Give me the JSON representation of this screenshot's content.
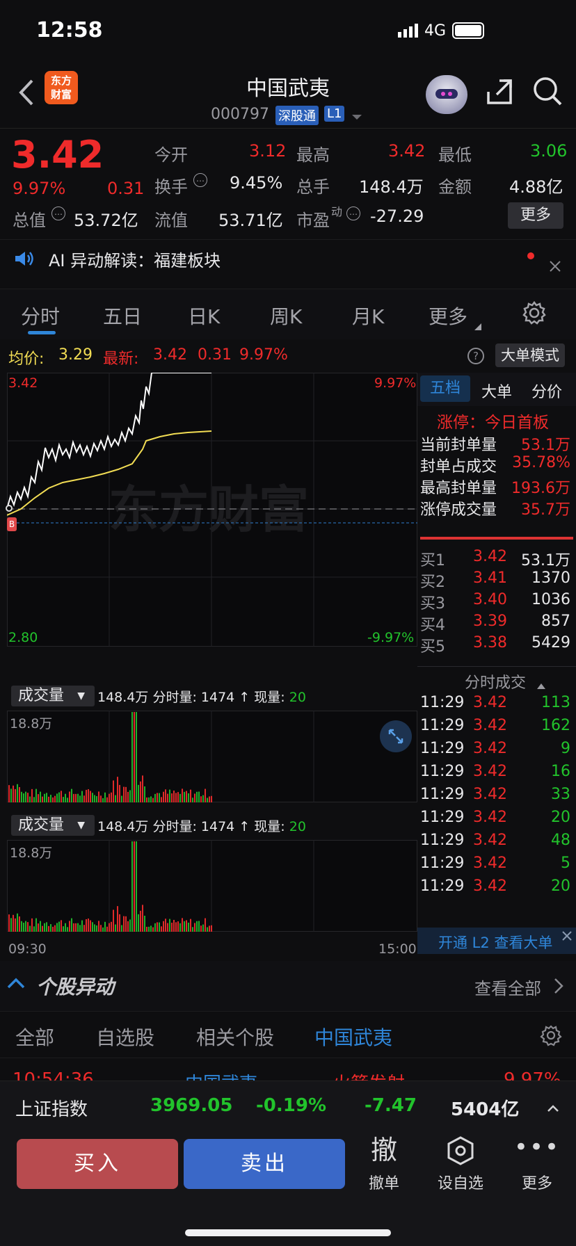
{
  "status": {
    "time": "12:58",
    "network": "4G"
  },
  "header": {
    "logo_line1": "东方",
    "logo_line2": "财富",
    "title": "中国武夷",
    "code": "000797",
    "badge1": "深股通",
    "badge2": "L1"
  },
  "quote": {
    "price": "3.42",
    "pct": "9.97%",
    "change": "0.31",
    "open_label": "今开",
    "open": "3.12",
    "high_label": "最高",
    "high": "3.42",
    "low_label": "最低",
    "low": "3.06",
    "turnover_label": "换手",
    "turnover": "9.45%",
    "vol_label": "总手",
    "vol": "148.4万",
    "amount_label": "金额",
    "amount": "4.88亿",
    "mcap_label": "总值",
    "mcap": "53.72亿",
    "float_label": "流值",
    "float": "53.71亿",
    "pe_label": "市盈",
    "pe_sup": "动",
    "pe": "-27.29",
    "more": "更多"
  },
  "ai": {
    "text": "AI 异动解读：福建板块"
  },
  "tabs": [
    "分时",
    "五日",
    "日K",
    "周K",
    "月K",
    "更多"
  ],
  "chart": {
    "avg_label": "均价:",
    "avg": "3.29",
    "latest_label": "最新:",
    "latest": "3.42",
    "latest_chg": "0.31",
    "latest_pct": "9.97%",
    "mode": "大单模式",
    "y_top": "3.42",
    "y_bottom": "2.80",
    "pct_top": "9.97%",
    "pct_bottom": "-9.97%",
    "watermark": "东方财富",
    "vol_label": "成交量",
    "vol_total": "148.4万",
    "vol_min_label": "分时量:",
    "vol_min": "1474",
    "vol_arrow": "↑",
    "vol_now_label": "现量:",
    "vol_now": "20",
    "vol_max": "18.8万",
    "time_start": "09:30",
    "time_end": "15:00"
  },
  "chart_data": {
    "type": "line",
    "title": "",
    "x_range": [
      "09:30",
      "15:00"
    ],
    "ylim": [
      2.8,
      3.42
    ],
    "pre_close": 3.11,
    "series": [
      {
        "name": "价格",
        "color": "#ffffff"
      },
      {
        "name": "均价",
        "color": "#f2dd54"
      }
    ]
  },
  "side": {
    "tabs": [
      "五档",
      "大单",
      "分价"
    ],
    "limit_title": "涨停：今日首板",
    "limit_rows": [
      {
        "k": "当前封单量",
        "v": "53.1万"
      },
      {
        "k": "封单占成交",
        "v": "35.78%"
      },
      {
        "k": "最高封单量",
        "v": "193.6万"
      },
      {
        "k": "涨停成交量",
        "v": "35.7万"
      }
    ],
    "bids": [
      {
        "k": "买1",
        "p": "3.42",
        "v": "53.1万"
      },
      {
        "k": "买2",
        "p": "3.41",
        "v": "1370"
      },
      {
        "k": "买3",
        "p": "3.40",
        "v": "1036"
      },
      {
        "k": "买4",
        "p": "3.39",
        "v": "857"
      },
      {
        "k": "买5",
        "p": "3.38",
        "v": "5429"
      }
    ],
    "ticks_title": "分时成交",
    "ticks": [
      {
        "t": "11:29",
        "p": "3.42",
        "v": "113"
      },
      {
        "t": "11:29",
        "p": "3.42",
        "v": "162"
      },
      {
        "t": "11:29",
        "p": "3.42",
        "v": "9"
      },
      {
        "t": "11:29",
        "p": "3.42",
        "v": "16"
      },
      {
        "t": "11:29",
        "p": "3.42",
        "v": "33"
      },
      {
        "t": "11:29",
        "p": "3.42",
        "v": "20"
      },
      {
        "t": "11:29",
        "p": "3.42",
        "v": "48"
      },
      {
        "t": "11:29",
        "p": "3.42",
        "v": "5"
      },
      {
        "t": "11:29",
        "p": "3.42",
        "v": "20"
      }
    ],
    "l2": "开通 L2 查看大单"
  },
  "topic": {
    "title": "个股异动",
    "all": "查看全部"
  },
  "subtabs": [
    "全部",
    "自选股",
    "相关个股",
    "中国武夷"
  ],
  "peek": {
    "time": "10:54:36",
    "name": "中国武夷",
    "event": "火箭发射",
    "pct": "9.97%"
  },
  "index": {
    "name": "上证指数",
    "value": "3969.05",
    "pct": "-0.19%",
    "chg": "-7.47",
    "amount": "5404亿"
  },
  "bottom": {
    "buy": "买入",
    "sell": "卖出",
    "cancel_glyph": "撤",
    "cancel": "撤单",
    "fav": "设自选",
    "more": "更多"
  }
}
